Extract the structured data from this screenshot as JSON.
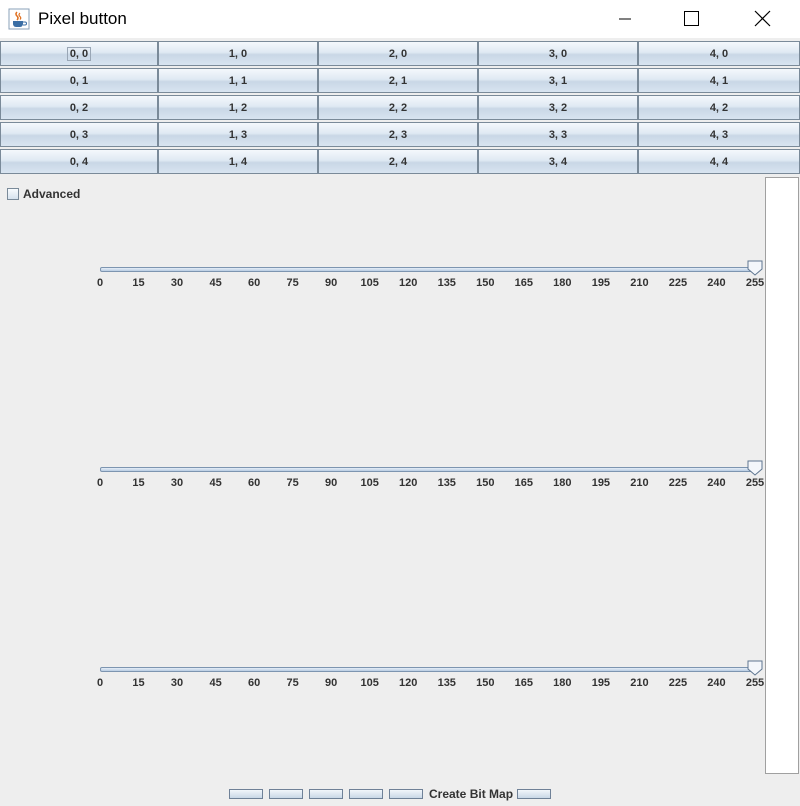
{
  "window": {
    "title": "Pixel button",
    "icon": "java-cup-icon",
    "controls": [
      "minimize-icon",
      "maximize-icon",
      "close-icon"
    ]
  },
  "grid": {
    "rows": [
      [
        "0, 0",
        "1, 0",
        "2, 0",
        "3, 0",
        "4, 0"
      ],
      [
        "0, 1",
        "1, 1",
        "2, 1",
        "3, 1",
        "4, 1"
      ],
      [
        "0, 2",
        "1, 2",
        "2, 2",
        "3, 2",
        "4, 2"
      ],
      [
        "0, 3",
        "1, 3",
        "2, 3",
        "3, 3",
        "4, 3"
      ],
      [
        "0, 4",
        "1, 4",
        "2, 4",
        "3, 4",
        "4, 4"
      ]
    ],
    "focused": "0, 0"
  },
  "advanced": {
    "label": "Advanced",
    "checked": false
  },
  "sliders": {
    "min": 0,
    "max": 255,
    "ticks": [
      "0",
      "15",
      "30",
      "45",
      "60",
      "75",
      "90",
      "105",
      "120",
      "135",
      "150",
      "165",
      "180",
      "195",
      "210",
      "225",
      "240",
      "255"
    ],
    "values": [
      255,
      255,
      255
    ]
  },
  "bottom": {
    "create_label": "Create Bit Map",
    "small_buttons_before": 5,
    "small_buttons_after": 1
  },
  "colors": {
    "background": "#eeeeee",
    "button_border": "#7a8a99"
  }
}
